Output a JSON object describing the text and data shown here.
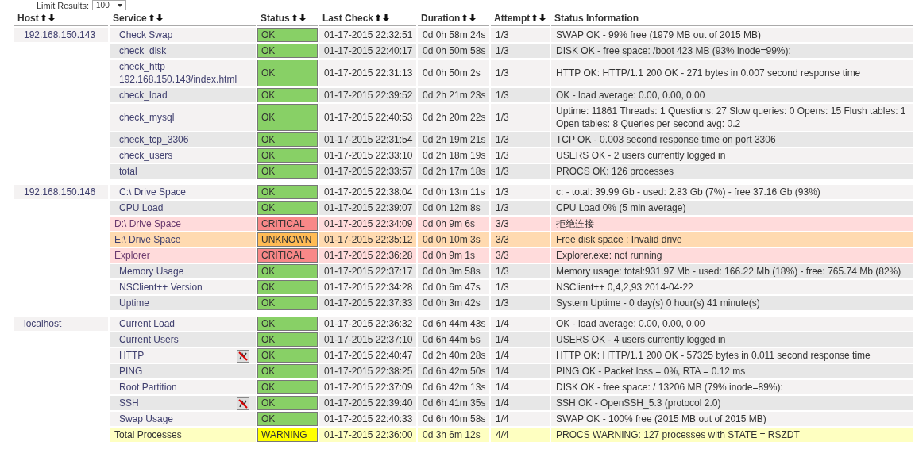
{
  "limit": {
    "label": "Limit Results:",
    "value": "100"
  },
  "columns": [
    {
      "label": "Host",
      "sortable": true
    },
    {
      "label": "Service",
      "sortable": true
    },
    {
      "label": "Status",
      "sortable": true
    },
    {
      "label": "Last Check",
      "sortable": true
    },
    {
      "label": "Duration",
      "sortable": true
    },
    {
      "label": "Attempt",
      "sortable": true
    },
    {
      "label": "Status Information",
      "sortable": false
    }
  ],
  "hosts": [
    {
      "name": "192.168.150.143",
      "services": [
        {
          "name": "Check Swap",
          "kind": "ok",
          "status": "OK",
          "last_check": "01-17-2015 22:32:51",
          "duration": "0d 0h 58m 24s",
          "attempt": "1/3",
          "info": "SWAP OK - 99% free (1979 MB out of 2015 MB)",
          "notifications_disabled": false
        },
        {
          "name": "check_disk",
          "kind": "ok",
          "status": "OK",
          "last_check": "01-17-2015 22:40:17",
          "duration": "0d 0h 50m 58s",
          "attempt": "1/3",
          "info": "DISK OK - free space: /boot 423 MB (93% inode=99%):",
          "notifications_disabled": false
        },
        {
          "name": "check_http 192.168.150.143/index.html",
          "kind": "ok",
          "status": "OK",
          "last_check": "01-17-2015 22:31:13",
          "duration": "0d 0h 50m 2s",
          "attempt": "1/3",
          "info": "HTTP OK: HTTP/1.1 200 OK - 271 bytes in 0.007 second response time",
          "notifications_disabled": false
        },
        {
          "name": "check_load",
          "kind": "ok",
          "status": "OK",
          "last_check": "01-17-2015 22:39:52",
          "duration": "0d 2h 21m 23s",
          "attempt": "1/3",
          "info": "OK - load average: 0.00, 0.00, 0.00",
          "notifications_disabled": false
        },
        {
          "name": "check_mysql",
          "kind": "ok",
          "status": "OK",
          "last_check": "01-17-2015 22:40:53",
          "duration": "0d 2h 20m 22s",
          "attempt": "1/3",
          "info": "Uptime: 11861 Threads: 1 Questions: 27 Slow queries: 0 Opens: 15 Flush tables: 1 Open tables: 8 Queries per second avg: 0.2",
          "notifications_disabled": false
        },
        {
          "name": "check_tcp_3306",
          "kind": "ok",
          "status": "OK",
          "last_check": "01-17-2015 22:31:54",
          "duration": "0d 2h 19m 21s",
          "attempt": "1/3",
          "info": "TCP OK - 0.003 second response time on port 3306",
          "notifications_disabled": false
        },
        {
          "name": "check_users",
          "kind": "ok",
          "status": "OK",
          "last_check": "01-17-2015 22:33:10",
          "duration": "0d 2h 18m 19s",
          "attempt": "1/3",
          "info": "USERS OK - 2 users currently logged in",
          "notifications_disabled": false
        },
        {
          "name": "total",
          "kind": "ok",
          "status": "OK",
          "last_check": "01-17-2015 22:33:57",
          "duration": "0d 2h 17m 18s",
          "attempt": "1/3",
          "info": "PROCS OK: 126 processes",
          "notifications_disabled": false
        }
      ]
    },
    {
      "name": "192.168.150.146",
      "services": [
        {
          "name": "C:\\ Drive Space",
          "kind": "ok",
          "status": "OK",
          "last_check": "01-17-2015 22:38:04",
          "duration": "0d 0h 13m 11s",
          "attempt": "1/3",
          "info": "c: - total: 39.99 Gb - used: 2.83 Gb (7%) - free 37.16 Gb (93%)",
          "notifications_disabled": false
        },
        {
          "name": "CPU Load",
          "kind": "ok",
          "status": "OK",
          "last_check": "01-17-2015 22:39:07",
          "duration": "0d 0h 12m 8s",
          "attempt": "1/3",
          "info": "CPU Load 0% (5 min average)",
          "notifications_disabled": false
        },
        {
          "name": "D:\\ Drive Space",
          "kind": "critical",
          "status": "CRITICAL",
          "last_check": "01-17-2015 22:34:09",
          "duration": "0d 0h 9m 6s",
          "attempt": "3/3",
          "info": "拒绝连接",
          "notifications_disabled": false
        },
        {
          "name": "E:\\ Drive Space",
          "kind": "unknown",
          "status": "UNKNOWN",
          "last_check": "01-17-2015 22:35:12",
          "duration": "0d 0h 10m 3s",
          "attempt": "3/3",
          "info": "Free disk space : Invalid drive",
          "notifications_disabled": false
        },
        {
          "name": "Explorer",
          "kind": "critical",
          "status": "CRITICAL",
          "last_check": "01-17-2015 22:36:28",
          "duration": "0d 0h 9m 1s",
          "attempt": "3/3",
          "info": "Explorer.exe: not running",
          "notifications_disabled": false
        },
        {
          "name": "Memory Usage",
          "kind": "ok",
          "status": "OK",
          "last_check": "01-17-2015 22:37:17",
          "duration": "0d 0h 3m 58s",
          "attempt": "1/3",
          "info": "Memory usage: total:931.97 Mb - used: 166.22 Mb (18%) - free: 765.74 Mb (82%)",
          "notifications_disabled": false
        },
        {
          "name": "NSClient++ Version",
          "kind": "ok",
          "status": "OK",
          "last_check": "01-17-2015 22:34:28",
          "duration": "0d 0h 6m 47s",
          "attempt": "1/3",
          "info": "NSClient++ 0,4,2,93 2014-04-22",
          "notifications_disabled": false
        },
        {
          "name": "Uptime",
          "kind": "ok",
          "status": "OK",
          "last_check": "01-17-2015 22:37:33",
          "duration": "0d 0h 3m 42s",
          "attempt": "1/3",
          "info": "System Uptime - 0 day(s) 0 hour(s) 41 minute(s)",
          "notifications_disabled": false
        }
      ]
    },
    {
      "name": "localhost",
      "services": [
        {
          "name": "Current Load",
          "kind": "ok",
          "status": "OK",
          "last_check": "01-17-2015 22:36:32",
          "duration": "0d 6h 44m 43s",
          "attempt": "1/4",
          "info": "OK - load average: 0.00, 0.00, 0.00",
          "notifications_disabled": false
        },
        {
          "name": "Current Users",
          "kind": "ok",
          "status": "OK",
          "last_check": "01-17-2015 22:37:10",
          "duration": "0d 6h 44m 5s",
          "attempt": "1/4",
          "info": "USERS OK - 4 users currently logged in",
          "notifications_disabled": false
        },
        {
          "name": "HTTP",
          "kind": "ok",
          "status": "OK",
          "last_check": "01-17-2015 22:40:47",
          "duration": "0d 2h 40m 28s",
          "attempt": "1/4",
          "info": "HTTP OK: HTTP/1.1 200 OK - 57325 bytes in 0.011 second response time",
          "notifications_disabled": true
        },
        {
          "name": "PING",
          "kind": "ok",
          "status": "OK",
          "last_check": "01-17-2015 22:38:25",
          "duration": "0d 6h 42m 50s",
          "attempt": "1/4",
          "info": "PING OK - Packet loss = 0%, RTA = 0.12 ms",
          "notifications_disabled": false
        },
        {
          "name": "Root Partition",
          "kind": "ok",
          "status": "OK",
          "last_check": "01-17-2015 22:37:09",
          "duration": "0d 6h 42m 13s",
          "attempt": "1/4",
          "info": "DISK OK - free space: / 13206 MB (79% inode=89%):",
          "notifications_disabled": false
        },
        {
          "name": "SSH",
          "kind": "ok",
          "status": "OK",
          "last_check": "01-17-2015 22:39:40",
          "duration": "0d 6h 41m 35s",
          "attempt": "1/4",
          "info": "SSH OK - OpenSSH_5.3 (protocol 2.0)",
          "notifications_disabled": true
        },
        {
          "name": "Swap Usage",
          "kind": "ok",
          "status": "OK",
          "last_check": "01-17-2015 22:40:33",
          "duration": "0d 6h 40m 58s",
          "attempt": "1/4",
          "info": "SWAP OK - 100% free (2015 MB out of 2015 MB)",
          "notifications_disabled": false
        },
        {
          "name": "Total Processes",
          "kind": "warning",
          "status": "WARNING",
          "last_check": "01-17-2015 22:36:00",
          "duration": "0d 3h 6m 12s",
          "attempt": "4/4",
          "info": "PROCS WARNING: 127 processes with STATE = RSZDT",
          "notifications_disabled": false
        }
      ]
    }
  ]
}
